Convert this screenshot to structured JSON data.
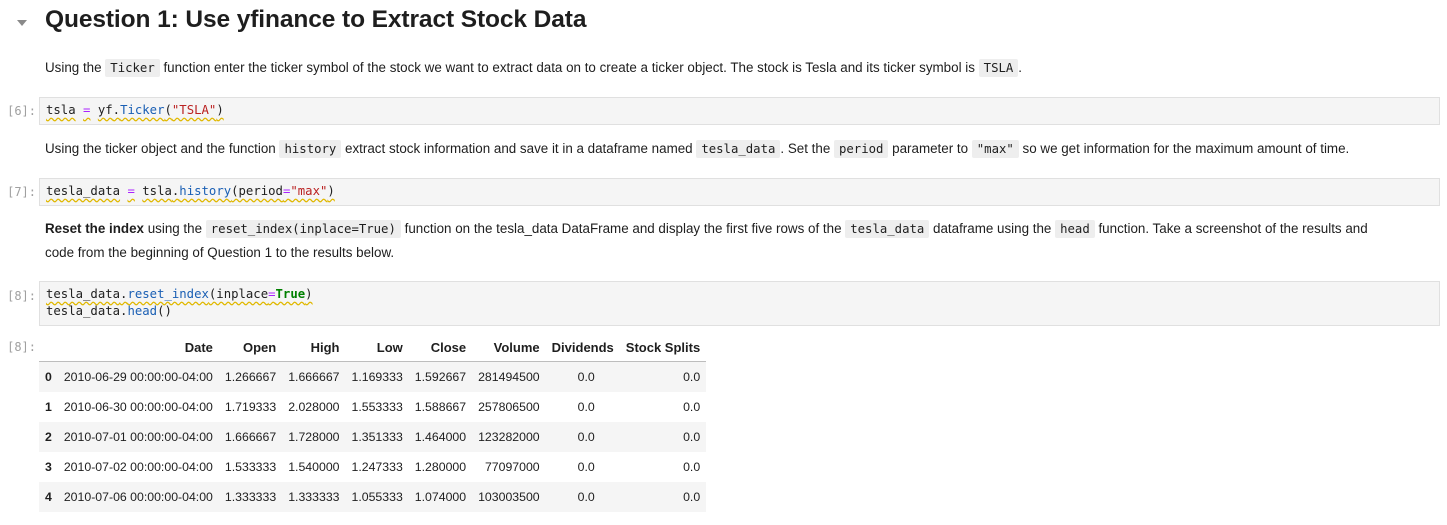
{
  "heading": "Question 1: Use yfinance to Extract Stock Data",
  "md1": {
    "t1": "Using the ",
    "c1": "Ticker",
    "t2": " function enter the ticker symbol of the stock we want to extract data on to create a ticker object. The stock is Tesla and its ticker symbol is ",
    "c2": "TSLA",
    "t3": "."
  },
  "cell6": {
    "prompt": "[6]:",
    "v": "tsla",
    "eq": "=",
    "mod": "yf",
    "dot": ".",
    "fn": "Ticker",
    "p1": "(",
    "str": "\"TSLA\"",
    "p2": ")"
  },
  "md2": {
    "t1": "Using the ticker object and the function ",
    "c1": "history",
    "t2": " extract stock information and save it in a dataframe named ",
    "c2": "tesla_data",
    "t3": ". Set the ",
    "c3": "period",
    "t4": " parameter to ",
    "c4": "\"max\"",
    "t5": " so we get information for the maximum amount of time."
  },
  "cell7": {
    "prompt": "[7]:",
    "v": "tesla_data",
    "eq": "=",
    "obj": "tsla",
    "dot": ".",
    "fn": "history",
    "p1": "(period",
    "eq2": "=",
    "str": "\"max\"",
    "p2": ")"
  },
  "md3": {
    "b": "Reset the index",
    "t1": " using the ",
    "c1": "reset_index(inplace=True)",
    "t2": " function on the tesla_data DataFrame and display the first five rows of the ",
    "c2": "tesla_data",
    "t3": " dataframe using the ",
    "c3": "head",
    "t4": " function. Take a screenshot of the results and",
    "line2": "code from the beginning of Question 1 to the results below."
  },
  "cell8": {
    "prompt": "[8]:",
    "l1_obj": "tesla_data",
    "l1_dot": ".",
    "l1_fn": "reset_index",
    "l1_p1": "(inplace",
    "l1_eq": "=",
    "l1_kw": "True",
    "l1_p2": ")",
    "l2_obj": "tesla_data",
    "l2_dot": ".",
    "l2_fn": "head",
    "l2_p": "()"
  },
  "out8": {
    "prompt": "[8]:",
    "columns": [
      "",
      "Date",
      "Open",
      "High",
      "Low",
      "Close",
      "Volume",
      "Dividends",
      "Stock Splits"
    ],
    "rows": [
      [
        "0",
        "2010-06-29 00:00:00-04:00",
        "1.266667",
        "1.666667",
        "1.169333",
        "1.592667",
        "281494500",
        "0.0",
        "0.0"
      ],
      [
        "1",
        "2010-06-30 00:00:00-04:00",
        "1.719333",
        "2.028000",
        "1.553333",
        "1.588667",
        "257806500",
        "0.0",
        "0.0"
      ],
      [
        "2",
        "2010-07-01 00:00:00-04:00",
        "1.666667",
        "1.728000",
        "1.351333",
        "1.464000",
        "123282000",
        "0.0",
        "0.0"
      ],
      [
        "3",
        "2010-07-02 00:00:00-04:00",
        "1.533333",
        "1.540000",
        "1.247333",
        "1.280000",
        "77097000",
        "0.0",
        "0.0"
      ],
      [
        "4",
        "2010-07-06 00:00:00-04:00",
        "1.333333",
        "1.333333",
        "1.055333",
        "1.074000",
        "103003500",
        "0.0",
        "0.0"
      ]
    ]
  }
}
